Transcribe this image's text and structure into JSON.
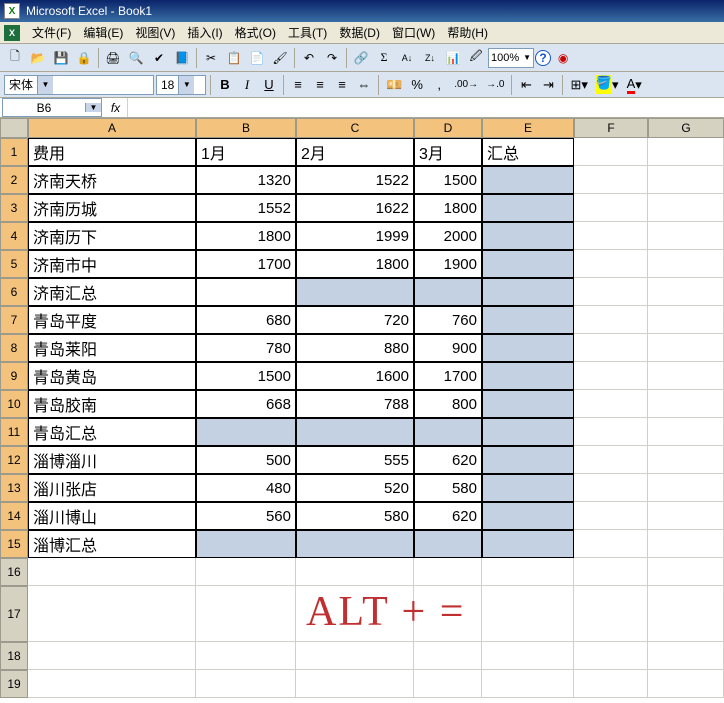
{
  "app": {
    "title": "Microsoft Excel - Book1"
  },
  "menu": [
    "文件(F)",
    "编辑(E)",
    "视图(V)",
    "插入(I)",
    "格式(O)",
    "工具(T)",
    "数据(D)",
    "窗口(W)",
    "帮助(H)"
  ],
  "format": {
    "font": "宋体",
    "size": "18"
  },
  "zoom": "100%",
  "namebox": "B6",
  "formula": "",
  "cols": [
    "A",
    "B",
    "C",
    "D",
    "E",
    "F",
    "G"
  ],
  "sel_cols": [
    "A",
    "B",
    "C",
    "D",
    "E"
  ],
  "chart_data": {
    "type": "table",
    "headers": [
      "费用",
      "1月",
      "2月",
      "3月",
      "汇总"
    ],
    "rows": [
      [
        "济南天桥",
        1320,
        1522,
        1500,
        null
      ],
      [
        "济南历城",
        1552,
        1622,
        1800,
        null
      ],
      [
        "济南历下",
        1800,
        1999,
        2000,
        null
      ],
      [
        "济南市中",
        1700,
        1800,
        1900,
        null
      ],
      [
        "济南汇总",
        null,
        null,
        null,
        null
      ],
      [
        "青岛平度",
        680,
        720,
        760,
        null
      ],
      [
        "青岛莱阳",
        780,
        880,
        900,
        null
      ],
      [
        "青岛黄岛",
        1500,
        1600,
        1700,
        null
      ],
      [
        "青岛胶南",
        668,
        788,
        800,
        null
      ],
      [
        "青岛汇总",
        null,
        null,
        null,
        null
      ],
      [
        "淄博淄川",
        500,
        555,
        620,
        null
      ],
      [
        "淄川张店",
        480,
        520,
        580,
        null
      ],
      [
        "淄川博山",
        560,
        580,
        620,
        null
      ],
      [
        "淄博汇总",
        null,
        null,
        null,
        null
      ]
    ]
  },
  "overlay": "ALT + =",
  "active_cell": "B6",
  "selected_rows_summary": [
    6,
    11,
    15
  ],
  "icons": {
    "new": "🗋",
    "open": "📂",
    "save": "💾",
    "perm": "🔒",
    "print": "🖨",
    "preview": "🔍",
    "spell": "✔",
    "research": "📘",
    "cut": "✂",
    "copy": "📋",
    "paste": "📄",
    "fmtpaint": "🖌",
    "undo": "↶",
    "redo": "↷",
    "link": "🔗",
    "sum": "Σ",
    "sortA": "A↓",
    "sortZ": "Z↓",
    "chart": "📊",
    "draw": "🖉",
    "help": "?",
    "ball": "◉"
  }
}
